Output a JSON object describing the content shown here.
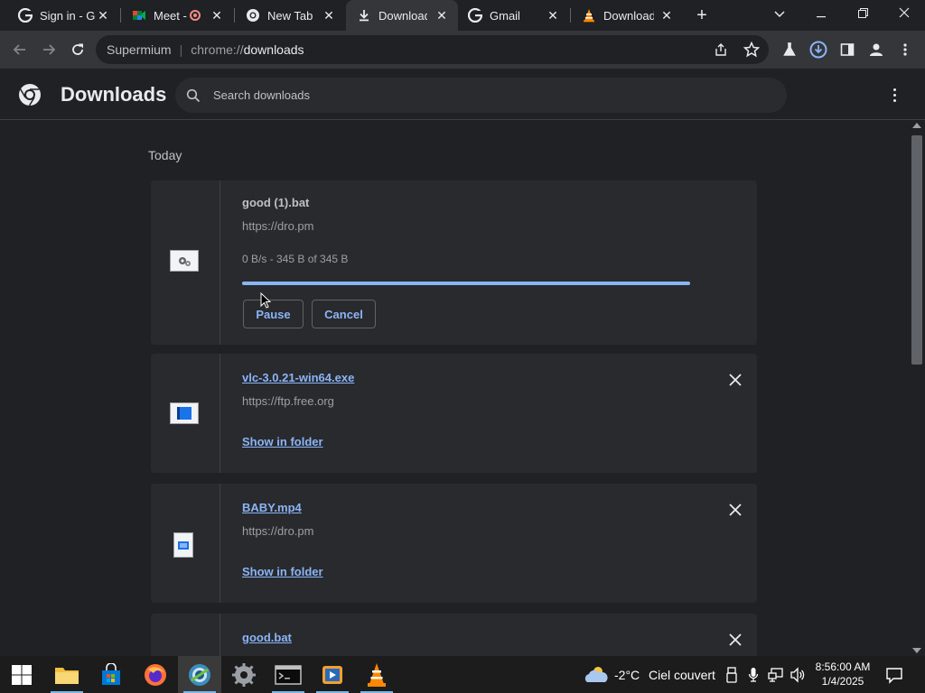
{
  "tabs": [
    {
      "label": "Sign in - Goo",
      "favicon": "google-icon",
      "active": false
    },
    {
      "label": "Meet - ",
      "favicon": "meet-icon",
      "active": false
    },
    {
      "label": "New Tab",
      "favicon": "chrome-icon",
      "active": false
    },
    {
      "label": "Download",
      "favicon": "download-icon",
      "active": true
    },
    {
      "label": "Gmail",
      "favicon": "google-icon",
      "active": false
    },
    {
      "label": "Download",
      "favicon": "vlc-icon",
      "active": false
    }
  ],
  "toolbar": {
    "browser_name": "Supermium",
    "url_scheme": "chrome://",
    "url_host": "downloads"
  },
  "header": {
    "title": "Downloads",
    "search_placeholder": "Search downloads"
  },
  "section_label": "Today",
  "downloads": [
    {
      "filename": "good (1).bat",
      "source": "https://dro.pm",
      "status": "0 B/s - 345 B of 345 B",
      "progress": 1.0,
      "pause_label": "Pause",
      "cancel_label": "Cancel",
      "icon": "gear-file-icon"
    },
    {
      "filename": "vlc-3.0.21-win64.exe",
      "source": "https://ftp.free.org",
      "action_label": "Show in folder",
      "icon": "installer-file-icon"
    },
    {
      "filename": "BABY.mp4",
      "source": "https://dro.pm",
      "action_label": "Show in folder",
      "icon": "video-file-icon"
    },
    {
      "filename": "good.bat",
      "icon": "gear-file-icon"
    }
  ],
  "taskbar": {
    "weather_temp": "-2°C",
    "weather_text": "Ciel couvert",
    "time": "8:56:00 AM",
    "date": "1/4/2025"
  },
  "colors": {
    "accent": "#8ab4f8",
    "background": "#202124",
    "card": "#292a2d"
  }
}
